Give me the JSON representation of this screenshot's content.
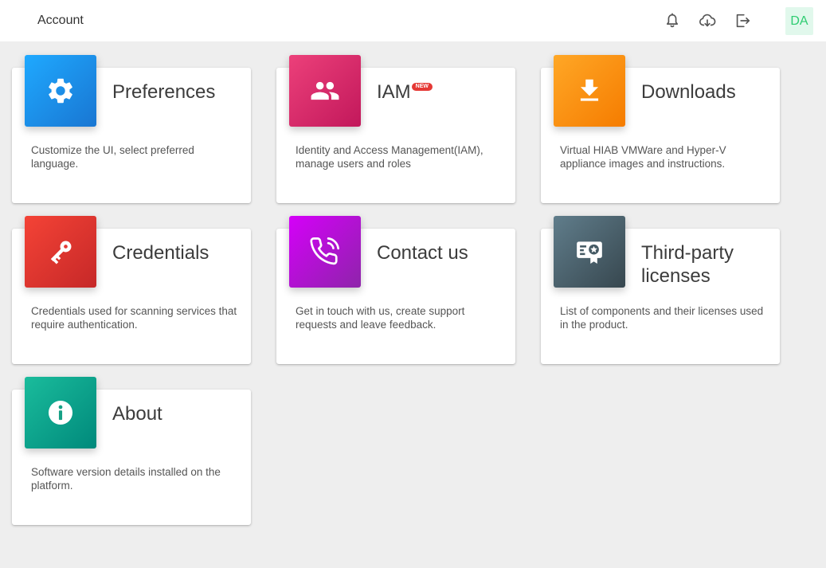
{
  "header": {
    "title": "Account",
    "avatar_initials": "DA",
    "icons": [
      "bell-icon",
      "cloud-download-icon",
      "logout-icon"
    ]
  },
  "cards": [
    {
      "title": "Preferences",
      "description": "Customize the UI, select preferred language.",
      "icon": "gear-icon",
      "color": "#1e88e5"
    },
    {
      "title": "IAM",
      "badge": "NEW",
      "description": "Identity and Access Management(IAM), manage users and roles",
      "icon": "users-icon",
      "color": "#d81b60"
    },
    {
      "title": "Downloads",
      "description": "Virtual HIAB VMWare and Hyper-V appliance images and instructions.",
      "icon": "download-icon",
      "color": "#fb8c00"
    },
    {
      "title": "Credentials",
      "description": "Credentials used for scanning services that require authentication.",
      "icon": "key-icon",
      "color": "#e53935"
    },
    {
      "title": "Contact us",
      "description": "Get in touch with us, create support requests and leave feedback.",
      "icon": "phone-icon",
      "color": "#aa00ff"
    },
    {
      "title": "Third-party licenses",
      "description": "List of components and their licenses used in the product.",
      "icon": "certificate-icon",
      "color": "#455a64"
    },
    {
      "title": "About",
      "description": "Software version details installed on the platform.",
      "icon": "info-icon",
      "color": "#00897b"
    }
  ]
}
